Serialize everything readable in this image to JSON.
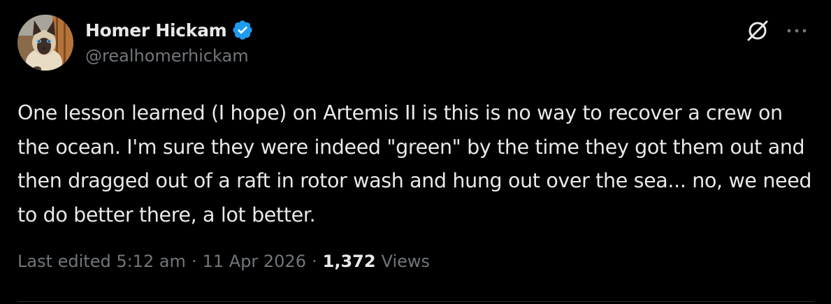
{
  "author": {
    "display_name": "Homer Hickam",
    "handle": "@realhomerhickam",
    "verified": true,
    "verified_color": "#1d9bf0",
    "avatar_icon": "siamese-cat-avatar"
  },
  "header_actions": {
    "grok_icon": "grok-icon",
    "more_icon": "more-horizontal-icon"
  },
  "tweet": {
    "text": "One lesson learned (I hope) on Artemis II is this is no way to recover a crew on the ocean. I'm sure they were indeed \"green\" by the time they got them out and then dragged out of a raft in rotor wash and hung out over the sea... no, we need to do better there, a lot better."
  },
  "meta": {
    "edited_label": "Last edited 5:12 am",
    "separator": "·",
    "date": "11 Apr 2026",
    "views_count": "1,372",
    "views_label": "Views"
  },
  "colors": {
    "background": "#000000",
    "primary_text": "#e7e9ea",
    "secondary_text": "#71767b",
    "divider": "#2f3336"
  }
}
